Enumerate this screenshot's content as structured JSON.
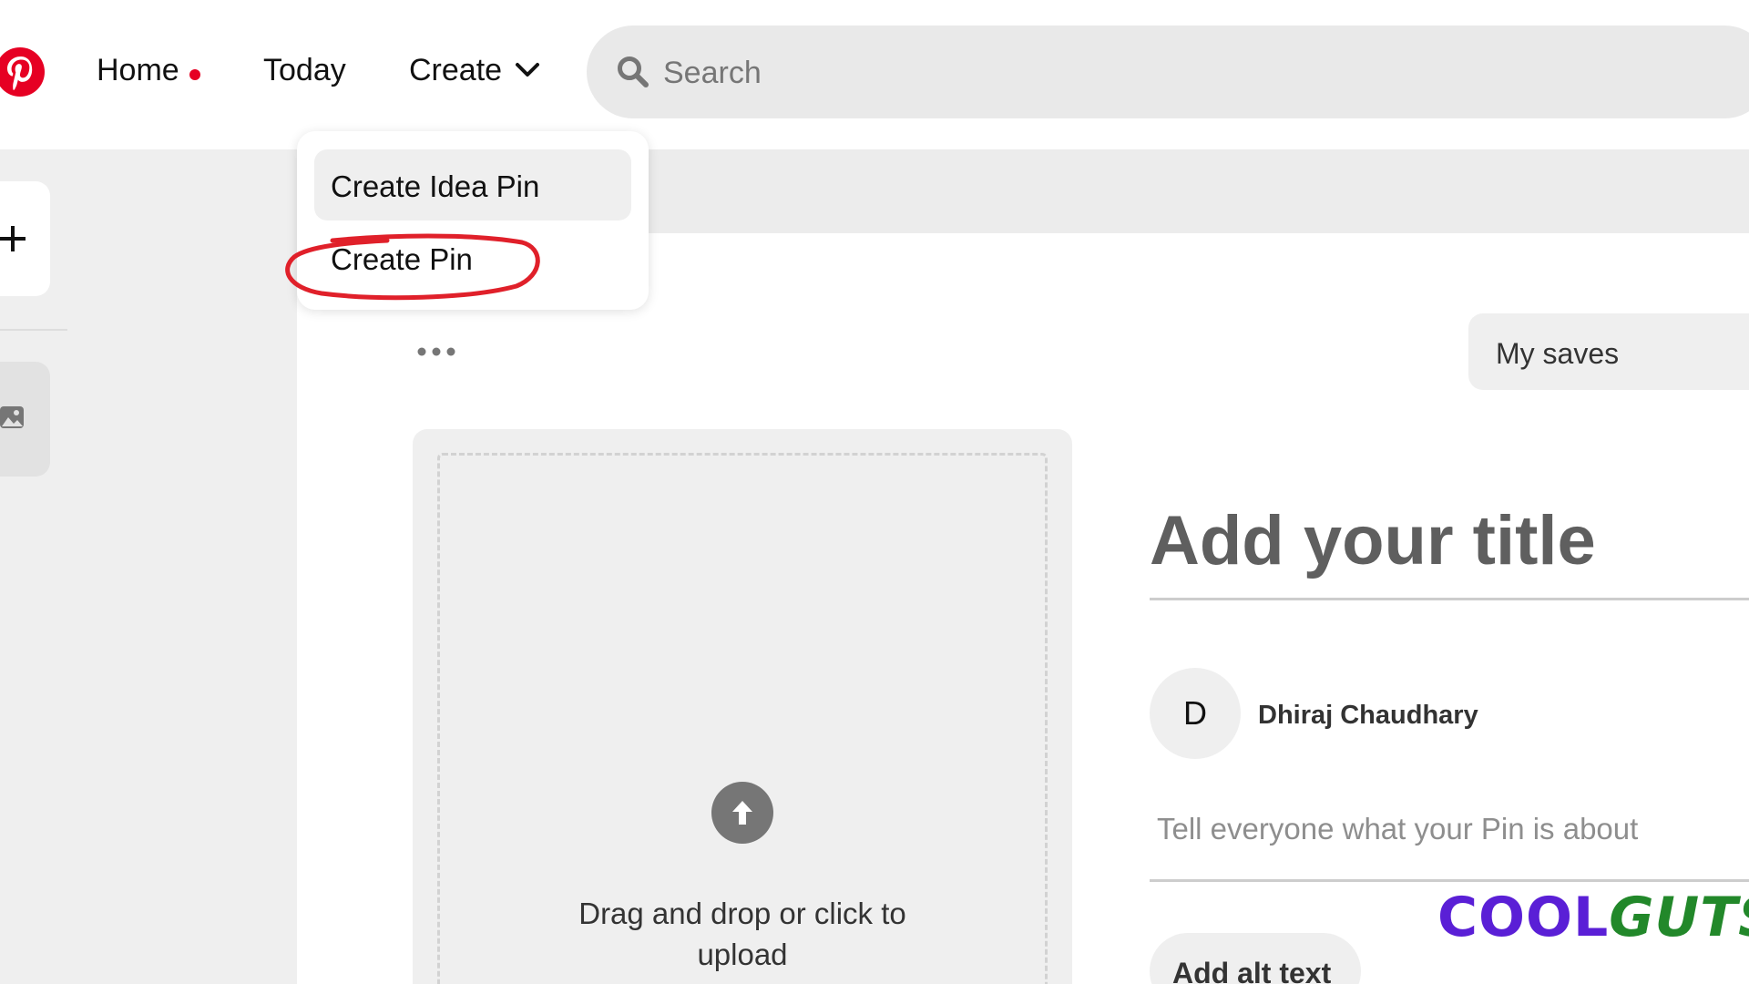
{
  "header": {
    "nav": {
      "home": "Home",
      "today": "Today",
      "create": "Create"
    },
    "search": {
      "placeholder": "Search"
    }
  },
  "create_menu": {
    "items": [
      {
        "label": "Create Idea Pin"
      },
      {
        "label": "Create Pin"
      }
    ]
  },
  "board_select": {
    "value": "My saves"
  },
  "upload": {
    "prompt_line1": "Drag and drop or click to",
    "prompt_line2": "upload"
  },
  "pin_form": {
    "title_placeholder": "Add your title",
    "user": {
      "initial": "D",
      "name": "Dhiraj Chaudhary"
    },
    "description_placeholder": "Tell everyone what your Pin is about",
    "alt_text_button": "Add alt text"
  },
  "watermark": {
    "part1": "COOL",
    "part2": "GUTS"
  },
  "colors": {
    "brand": "#e60023",
    "annotation": "#e0202a",
    "watermark_cool": "#5a1fd6",
    "watermark_guts": "#22882a"
  },
  "icons": [
    "pinterest-logo-icon",
    "chevron-down-icon",
    "search-icon",
    "plus-icon",
    "image-icon",
    "more-dots-icon",
    "upload-arrow-icon"
  ]
}
